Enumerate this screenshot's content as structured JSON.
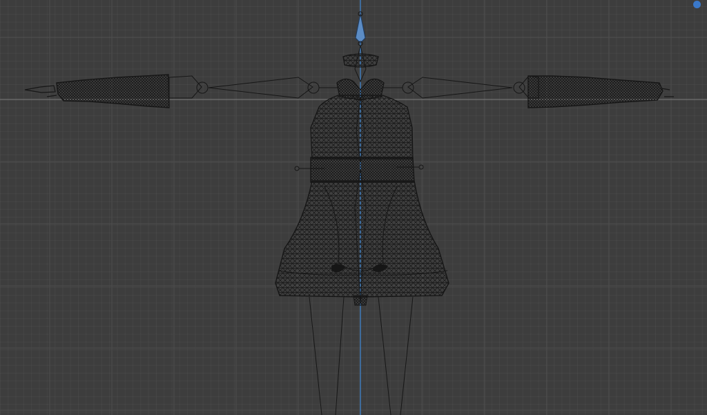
{
  "viewport": {
    "mode": "wireframe",
    "view": "front-orthographic",
    "background_color": "#3d3d3d",
    "grid_color": "#4a4a4a",
    "axis_color": "#808080",
    "z_axis_color": "#3f7fc3",
    "wire_color": "#141414"
  },
  "navigation_gizmo": {
    "icon": "axis-dot-icon",
    "color": "#3a78c9"
  },
  "scene_objects": [
    {
      "name": "dress-mesh",
      "icon": "mesh-icon"
    },
    {
      "name": "left-sleeve-mesh",
      "icon": "mesh-icon"
    },
    {
      "name": "right-sleeve-mesh",
      "icon": "mesh-icon"
    },
    {
      "name": "armature",
      "icon": "armature-icon"
    }
  ]
}
